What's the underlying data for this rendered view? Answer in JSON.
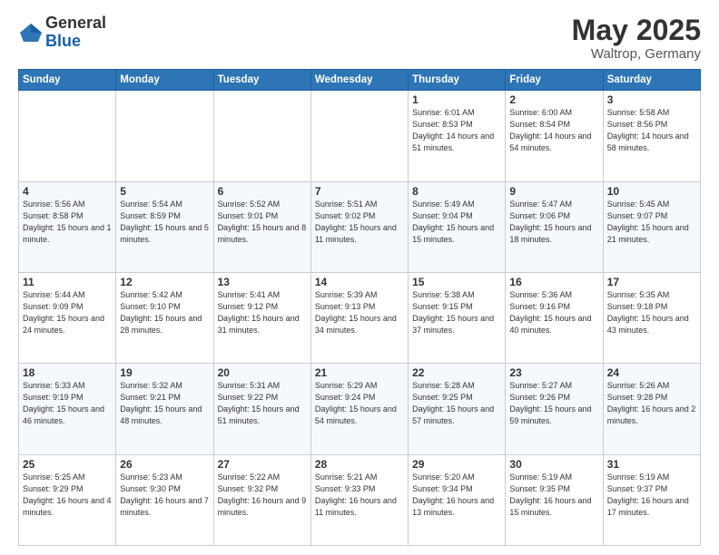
{
  "header": {
    "logo_general": "General",
    "logo_blue": "Blue",
    "main_title": "May 2025",
    "subtitle": "Waltrop, Germany"
  },
  "calendar": {
    "days_of_week": [
      "Sunday",
      "Monday",
      "Tuesday",
      "Wednesday",
      "Thursday",
      "Friday",
      "Saturday"
    ],
    "weeks": [
      [
        {
          "day": "",
          "info": ""
        },
        {
          "day": "",
          "info": ""
        },
        {
          "day": "",
          "info": ""
        },
        {
          "day": "",
          "info": ""
        },
        {
          "day": "1",
          "info": "Sunrise: 6:01 AM\nSunset: 8:53 PM\nDaylight: 14 hours\nand 51 minutes."
        },
        {
          "day": "2",
          "info": "Sunrise: 6:00 AM\nSunset: 8:54 PM\nDaylight: 14 hours\nand 54 minutes."
        },
        {
          "day": "3",
          "info": "Sunrise: 5:58 AM\nSunset: 8:56 PM\nDaylight: 14 hours\nand 58 minutes."
        }
      ],
      [
        {
          "day": "4",
          "info": "Sunrise: 5:56 AM\nSunset: 8:58 PM\nDaylight: 15 hours\nand 1 minute."
        },
        {
          "day": "5",
          "info": "Sunrise: 5:54 AM\nSunset: 8:59 PM\nDaylight: 15 hours\nand 5 minutes."
        },
        {
          "day": "6",
          "info": "Sunrise: 5:52 AM\nSunset: 9:01 PM\nDaylight: 15 hours\nand 8 minutes."
        },
        {
          "day": "7",
          "info": "Sunrise: 5:51 AM\nSunset: 9:02 PM\nDaylight: 15 hours\nand 11 minutes."
        },
        {
          "day": "8",
          "info": "Sunrise: 5:49 AM\nSunset: 9:04 PM\nDaylight: 15 hours\nand 15 minutes."
        },
        {
          "day": "9",
          "info": "Sunrise: 5:47 AM\nSunset: 9:06 PM\nDaylight: 15 hours\nand 18 minutes."
        },
        {
          "day": "10",
          "info": "Sunrise: 5:45 AM\nSunset: 9:07 PM\nDaylight: 15 hours\nand 21 minutes."
        }
      ],
      [
        {
          "day": "11",
          "info": "Sunrise: 5:44 AM\nSunset: 9:09 PM\nDaylight: 15 hours\nand 24 minutes."
        },
        {
          "day": "12",
          "info": "Sunrise: 5:42 AM\nSunset: 9:10 PM\nDaylight: 15 hours\nand 28 minutes."
        },
        {
          "day": "13",
          "info": "Sunrise: 5:41 AM\nSunset: 9:12 PM\nDaylight: 15 hours\nand 31 minutes."
        },
        {
          "day": "14",
          "info": "Sunrise: 5:39 AM\nSunset: 9:13 PM\nDaylight: 15 hours\nand 34 minutes."
        },
        {
          "day": "15",
          "info": "Sunrise: 5:38 AM\nSunset: 9:15 PM\nDaylight: 15 hours\nand 37 minutes."
        },
        {
          "day": "16",
          "info": "Sunrise: 5:36 AM\nSunset: 9:16 PM\nDaylight: 15 hours\nand 40 minutes."
        },
        {
          "day": "17",
          "info": "Sunrise: 5:35 AM\nSunset: 9:18 PM\nDaylight: 15 hours\nand 43 minutes."
        }
      ],
      [
        {
          "day": "18",
          "info": "Sunrise: 5:33 AM\nSunset: 9:19 PM\nDaylight: 15 hours\nand 46 minutes."
        },
        {
          "day": "19",
          "info": "Sunrise: 5:32 AM\nSunset: 9:21 PM\nDaylight: 15 hours\nand 48 minutes."
        },
        {
          "day": "20",
          "info": "Sunrise: 5:31 AM\nSunset: 9:22 PM\nDaylight: 15 hours\nand 51 minutes."
        },
        {
          "day": "21",
          "info": "Sunrise: 5:29 AM\nSunset: 9:24 PM\nDaylight: 15 hours\nand 54 minutes."
        },
        {
          "day": "22",
          "info": "Sunrise: 5:28 AM\nSunset: 9:25 PM\nDaylight: 15 hours\nand 57 minutes."
        },
        {
          "day": "23",
          "info": "Sunrise: 5:27 AM\nSunset: 9:26 PM\nDaylight: 15 hours\nand 59 minutes."
        },
        {
          "day": "24",
          "info": "Sunrise: 5:26 AM\nSunset: 9:28 PM\nDaylight: 16 hours\nand 2 minutes."
        }
      ],
      [
        {
          "day": "25",
          "info": "Sunrise: 5:25 AM\nSunset: 9:29 PM\nDaylight: 16 hours\nand 4 minutes."
        },
        {
          "day": "26",
          "info": "Sunrise: 5:23 AM\nSunset: 9:30 PM\nDaylight: 16 hours\nand 7 minutes."
        },
        {
          "day": "27",
          "info": "Sunrise: 5:22 AM\nSunset: 9:32 PM\nDaylight: 16 hours\nand 9 minutes."
        },
        {
          "day": "28",
          "info": "Sunrise: 5:21 AM\nSunset: 9:33 PM\nDaylight: 16 hours\nand 11 minutes."
        },
        {
          "day": "29",
          "info": "Sunrise: 5:20 AM\nSunset: 9:34 PM\nDaylight: 16 hours\nand 13 minutes."
        },
        {
          "day": "30",
          "info": "Sunrise: 5:19 AM\nSunset: 9:35 PM\nDaylight: 16 hours\nand 15 minutes."
        },
        {
          "day": "31",
          "info": "Sunrise: 5:19 AM\nSunset: 9:37 PM\nDaylight: 16 hours\nand 17 minutes."
        }
      ]
    ]
  }
}
